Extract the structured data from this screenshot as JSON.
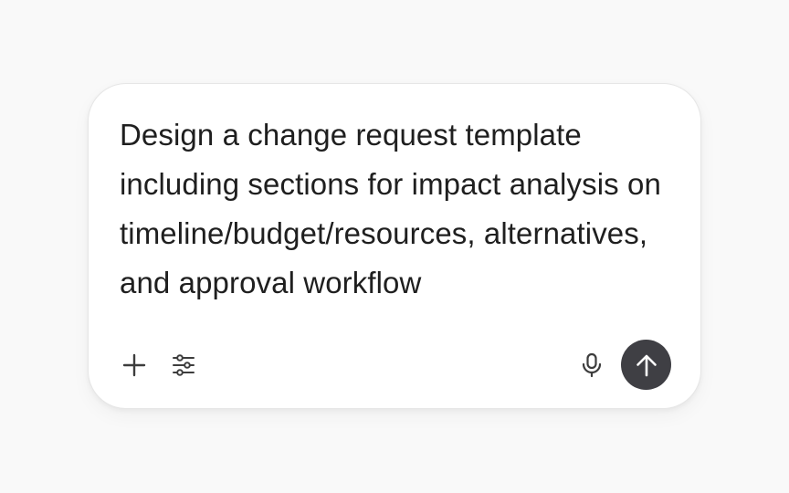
{
  "composer": {
    "prompt_text": "Design a change request template including sections for impact analysis on timeline/budget/resources, alternatives, and approval workflow",
    "toolbar": {
      "left_icons": [
        "plus-icon",
        "sliders-icon"
      ],
      "right_icons": [
        "microphone-icon",
        "arrow-up-icon"
      ]
    },
    "colors": {
      "background": "#f9f9f9",
      "card": "#ffffff",
      "text": "#1f1f1f",
      "icon": "#3d3d3d",
      "send_button": "#3f3f44"
    }
  }
}
